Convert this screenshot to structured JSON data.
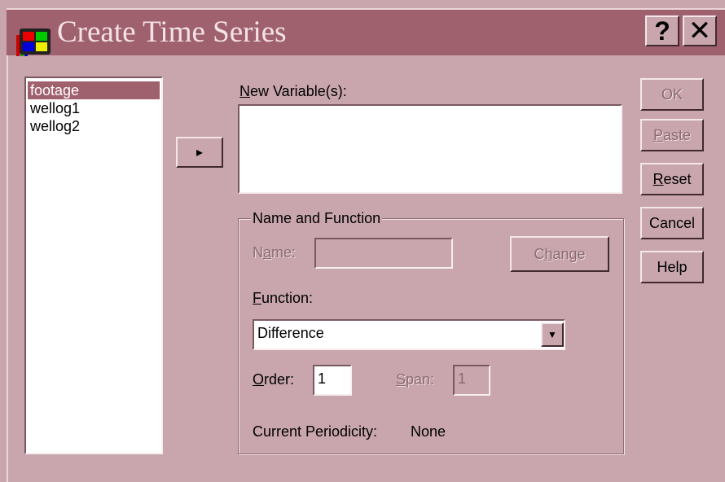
{
  "window": {
    "title": "Create Time Series",
    "help_button": "?",
    "close_button": "✕"
  },
  "source_list": {
    "items": [
      {
        "label": "footage",
        "selected": true
      },
      {
        "label": "wellog1",
        "selected": false
      },
      {
        "label": "wellog2",
        "selected": false
      }
    ]
  },
  "move_button": {
    "glyph": "▸"
  },
  "new_variables": {
    "label_mnemonic": "N",
    "label_rest": "ew Variable(s):",
    "items": []
  },
  "side_buttons": {
    "ok": "OK",
    "paste_mnemonic": "P",
    "paste_rest": "aste",
    "reset_mnemonic": "R",
    "reset_rest": "eset",
    "cancel": "Cancel",
    "help": "Help"
  },
  "name_function": {
    "group_title": "Name and Function",
    "name_label_pre": "N",
    "name_label_mnemonic": "a",
    "name_label_post": "me:",
    "name_value": "",
    "change_pre": "C",
    "change_mnemonic": "h",
    "change_post": "ange",
    "function_mnemonic": "F",
    "function_rest": "unction:",
    "function_value": "Difference",
    "order_mnemonic": "O",
    "order_rest": "rder:",
    "order_value": "1",
    "span_mnemonic": "S",
    "span_rest": "pan:",
    "span_value": "1",
    "periodicity_label": "Current Periodicity:",
    "periodicity_value": "None"
  },
  "colors": {
    "face": "#c9a6ad",
    "titlebar": "#a0616f",
    "selection": "#a0616f"
  }
}
